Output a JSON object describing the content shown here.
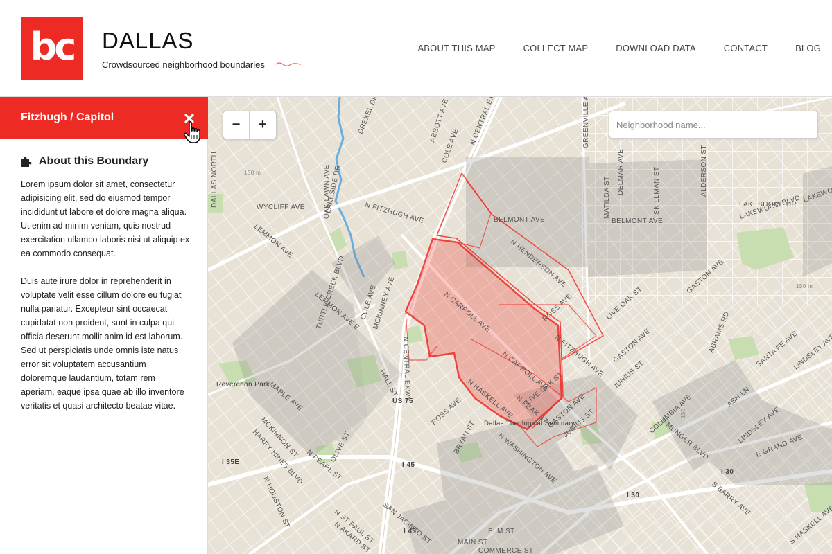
{
  "header": {
    "logo_text": "bc",
    "title": "DALLAS",
    "subtitle": "Crowdsourced neighborhood boundaries",
    "nav": [
      {
        "label": "ABOUT THIS MAP"
      },
      {
        "label": "COLLECT MAP"
      },
      {
        "label": "DOWNLOAD DATA"
      },
      {
        "label": "CONTACT"
      },
      {
        "label": "BLOG"
      }
    ]
  },
  "sidebar": {
    "boundary_name": "Fitzhugh / Capitol",
    "about_title": "About this Boundary",
    "paragraphs": [
      "Lorem ipsum dolor sit amet, consectetur adipisicing elit, sed do eiusmod tempor incididunt ut labore et dolore magna aliqua. Ut enim ad minim veniam, quis nostrud exercitation ullamco laboris nisi ut aliquip ex ea commodo consequat.",
      "Duis aute irure dolor in reprehenderit in voluptate velit esse cillum dolore eu fugiat nulla pariatur. Excepteur sint occaecat cupidatat non proident, sunt in culpa qui officia deserunt mollit anim id est laborum. Sed ut perspiciatis unde omnis iste natus error sit voluptatem accusantium doloremque laudantium, totam rem aperiam, eaque ipsa quae ab illo inventore veritatis et quasi architecto beatae vitae."
    ]
  },
  "map": {
    "zoom_out": "−",
    "zoom_in": "+",
    "search_placeholder": "Neighborhood name...",
    "colors": {
      "accent": "#ee2a24",
      "base": "#e8e2d6",
      "road": "#ffffff",
      "park": "#c8deb0",
      "overlay": "#7a7a7a"
    },
    "labels": {
      "dallas_north": "DALLAS NORTH",
      "lakeside": "LAKESIDE DR",
      "drexel": "DREXEL DR",
      "abbott": "ABBOTT AVE",
      "cole_top": "COLE AVE",
      "n_central": "N CENTRAL EXWY",
      "greenville": "GREENVILLE AVE",
      "delmar": "DELMAR AVE",
      "skillman": "SKILLMAN ST",
      "alderson": "ALDERSON ST",
      "oak_lawn": "OAK LAWN AVE",
      "wycliff": "WYCLIFF AVE",
      "fitzhugh": "N FITZHUGH AVE",
      "matilda": "MATILDA ST",
      "belmont1": "BELMONT AVE",
      "belmont2": "BELMONT AVE",
      "lakeshore": "LAKESHORE DR",
      "lakewood_blvd": "LAKEWOOD BLVD",
      "lakewood": "LAKEWOOD",
      "lemmon": "LEMMON AVE",
      "n_henderson": "N HENDERSON AVE",
      "gaston_top": "GASTON AVE",
      "live_oak": "LIVE OAK ST",
      "turtle": "TURTLE CREEK BLVD",
      "lemmon_e": "LEMMON AVE E",
      "cole": "COLE AVE",
      "mckinney": "MCKINNEY AVE",
      "n_carroll1": "N CARROLL AVE",
      "ross1": "ROSS AVE",
      "gaston2": "GASTON AVE",
      "n_fitzhugh2": "N FITZHUGH AVE",
      "n_carroll2": "N CARROLL AVE",
      "abrams": "ABRAMS RD",
      "santa_fe": "SANTA FE AVE",
      "lindsley": "LINDSLEY AVE",
      "n_central2": "N CENTRAL EXWY",
      "hall": "HALL ST",
      "reverchon": "Reverchon Park",
      "maple": "MAPLE AVE",
      "live_oak2": "LIVE OAK ST",
      "n_haskell": "N HASKELL AVE",
      "n_peak": "N PEAK ST",
      "gaston3": "GASTON AVE",
      "junius1": "JUNIUS ST",
      "junius2": "JUNIUS ST",
      "columbia": "COLUMBIA AVE",
      "ash": "ASH LN",
      "lindsley2": "LINDSLEY AVE",
      "us75": "US 75",
      "ross2": "ROSS AVE",
      "seminary": "Dallas Theological Seminary",
      "s_munger": "S MUNGER BLVD",
      "mckinnon": "MCKINNON ST",
      "harry_hines": "HARRY HINES BLVD",
      "bryan": "BRYAN ST",
      "n_washington": "N WASHINGTON AVE",
      "i35e": "I 35E",
      "n_pearl": "N PEARL ST",
      "i45": "I 45",
      "olive": "OLIVE ST",
      "i30": "I 30",
      "e_grand": "E GRAND AVE",
      "n_houston": "N HOUSTON ST",
      "i30b": "I 30",
      "s_barry": "S BARRY AVE",
      "n_st_paul": "N ST PAUL ST",
      "n_akard": "N AKARD ST",
      "i45b": "I 45",
      "elm": "ELM ST",
      "main": "MAIN ST",
      "commerce": "COMMERCE ST",
      "s_haskell": "S HASKELL AVE",
      "san_jacinto": "SAN JACINTO ST",
      "m150a": "150 m",
      "m150b": "150 m",
      "m150c": "150 m"
    }
  }
}
